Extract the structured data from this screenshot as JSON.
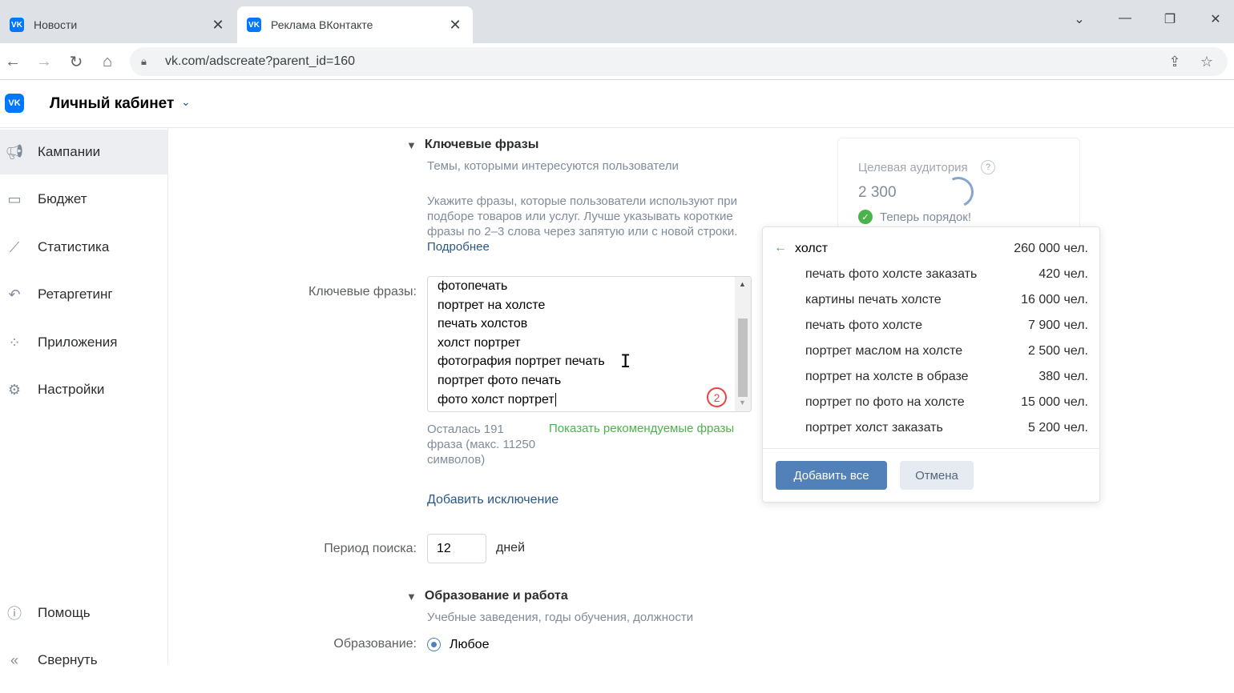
{
  "browser": {
    "tabs": [
      {
        "title": "Новости",
        "favicon": "vk-icon"
      },
      {
        "title": "Реклама ВКонтакте",
        "favicon": "vk-icon"
      }
    ],
    "url": "vk.com/adscreate?parent_id=160"
  },
  "header": {
    "title": "Личный кабинет"
  },
  "sidebar": {
    "items": [
      {
        "label": "Кампании",
        "icon": "megaphone-icon",
        "active": true
      },
      {
        "label": "Бюджет",
        "icon": "wallet-icon"
      },
      {
        "label": "Статистика",
        "icon": "chart-icon"
      },
      {
        "label": "Ретаргетинг",
        "icon": "retarget-icon"
      },
      {
        "label": "Приложения",
        "icon": "apps-icon"
      },
      {
        "label": "Настройки",
        "icon": "gear-icon"
      }
    ],
    "bottom": [
      {
        "label": "Помощь",
        "icon": "help-icon"
      },
      {
        "label": "Свернуть",
        "icon": "collapse-icon"
      }
    ]
  },
  "keywords": {
    "section_title": "Ключевые фразы",
    "section_subtitle": "Темы, которыми интересуются пользователи",
    "hint": "Укажите фразы, которые пользователи используют при подборе товаров или услуг. Лучше указывать короткие фразы по 2–3 слова через запятую или с новой строки.",
    "hint_link": "Подробнее",
    "field_label": "Ключевые фразы:",
    "lines": [
      "фотопечать",
      "портрет на холсте",
      "печать холстов",
      "холст портрет",
      "фотография портрет печать",
      "портрет фото печать",
      "фото холст портрет"
    ],
    "badge": "2",
    "remaining": "Осталась 191 фраза (макс. 11250 символов)",
    "show_recommended": "Показать рекомендуемые фразы",
    "add_exclusion": "Добавить исключение"
  },
  "period": {
    "label": "Период поиска:",
    "value": "12",
    "unit": "дней"
  },
  "education": {
    "section_title": "Образование и работа",
    "section_subtitle": "Учебные заведения, годы обучения, должности",
    "field_label": "Образование:",
    "option": "Любое"
  },
  "audience": {
    "title": "Целевая аудитория",
    "help": "?",
    "value": "2 300",
    "status": "Теперь порядок!"
  },
  "suggestions": {
    "head": {
      "term": "холст",
      "count": "260 000 чел."
    },
    "items": [
      {
        "term": "печать фото холсте заказать",
        "count": "420 чел."
      },
      {
        "term": "картины печать холсте",
        "count": "16 000 чел."
      },
      {
        "term": "печать фото холсте",
        "count": "7 900 чел."
      },
      {
        "term": "портрет маслом на холсте",
        "count": "2 500 чел."
      },
      {
        "term": "портрет на холсте в образе",
        "count": "380 чел."
      },
      {
        "term": "портрет по фото на холсте",
        "count": "15 000 чел."
      },
      {
        "term": "портрет холст заказать",
        "count": "5 200 чел."
      }
    ],
    "add_all": "Добавить все",
    "cancel": "Отмена"
  },
  "colors": {
    "vk_blue": "#0077ff",
    "button_blue": "#5181b8",
    "link": "#2a5885",
    "green": "#4bb34b",
    "badge_red": "#e64646"
  }
}
